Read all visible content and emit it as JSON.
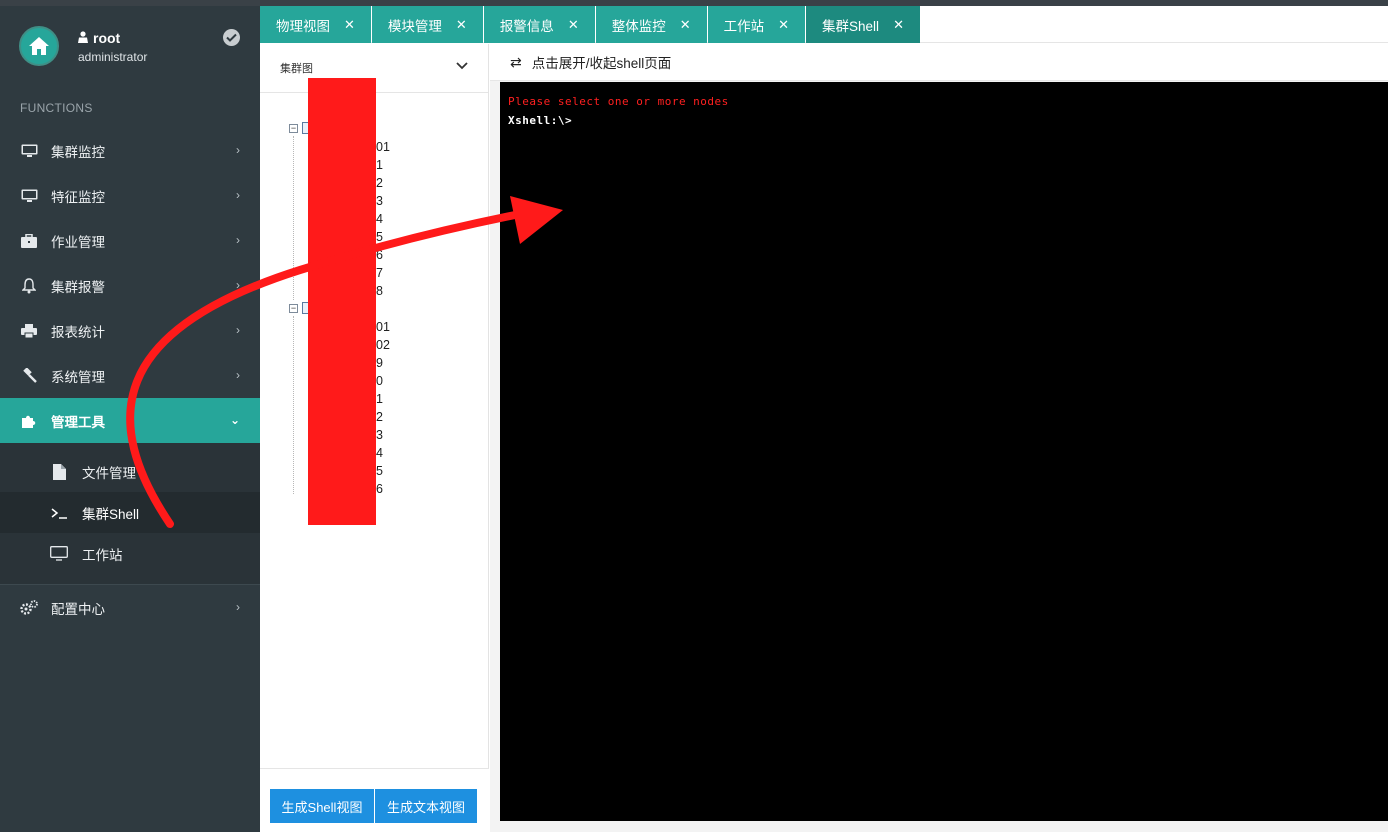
{
  "user": {
    "name": "root",
    "role": "administrator"
  },
  "sidebar": {
    "section_title": "FUNCTIONS",
    "items": [
      {
        "label": "集群监控",
        "icon": "monitor-icon"
      },
      {
        "label": "特征监控",
        "icon": "monitor-icon"
      },
      {
        "label": "作业管理",
        "icon": "briefcase-icon"
      },
      {
        "label": "集群报警",
        "icon": "bell-icon"
      },
      {
        "label": "报表统计",
        "icon": "printer-icon"
      },
      {
        "label": "系统管理",
        "icon": "gavel-icon"
      },
      {
        "label": "管理工具",
        "icon": "puzzle-icon",
        "active": true
      }
    ],
    "subitems": [
      {
        "label": "文件管理",
        "icon": "file-icon"
      },
      {
        "label": "集群Shell",
        "icon": "terminal-icon",
        "current": true
      },
      {
        "label": "工作站",
        "icon": "desktop-icon"
      }
    ],
    "config": {
      "label": "配置中心",
      "icon": "cogs-icon"
    }
  },
  "tabs": [
    {
      "label": "物理视图"
    },
    {
      "label": "模块管理"
    },
    {
      "label": "报警信息"
    },
    {
      "label": "整体监控"
    },
    {
      "label": "工作站"
    },
    {
      "label": "集群Shell",
      "active": true
    }
  ],
  "tree_panel": {
    "selector_label": "集群图",
    "group1_nodes": [
      "01",
      "1",
      "2",
      "3",
      "4",
      "5",
      "6",
      "7",
      "8"
    ],
    "group2_nodes": [
      "01",
      "02",
      "9",
      "0",
      "1",
      "2",
      "3",
      "4",
      "5",
      "6"
    ],
    "buttons": {
      "shell_view": "生成Shell视图",
      "text_view": "生成文本视图"
    }
  },
  "shell_panel": {
    "toggle_label": "点击展开/收起shell页面",
    "terminal": {
      "error_line": "Please select one or more nodes",
      "prompt": "Xshell:\\>"
    }
  },
  "colors": {
    "accent": "#26a69a",
    "sidebar": "#2f3a40",
    "button": "#1e90e0",
    "annotation": "#ff1a1a"
  }
}
